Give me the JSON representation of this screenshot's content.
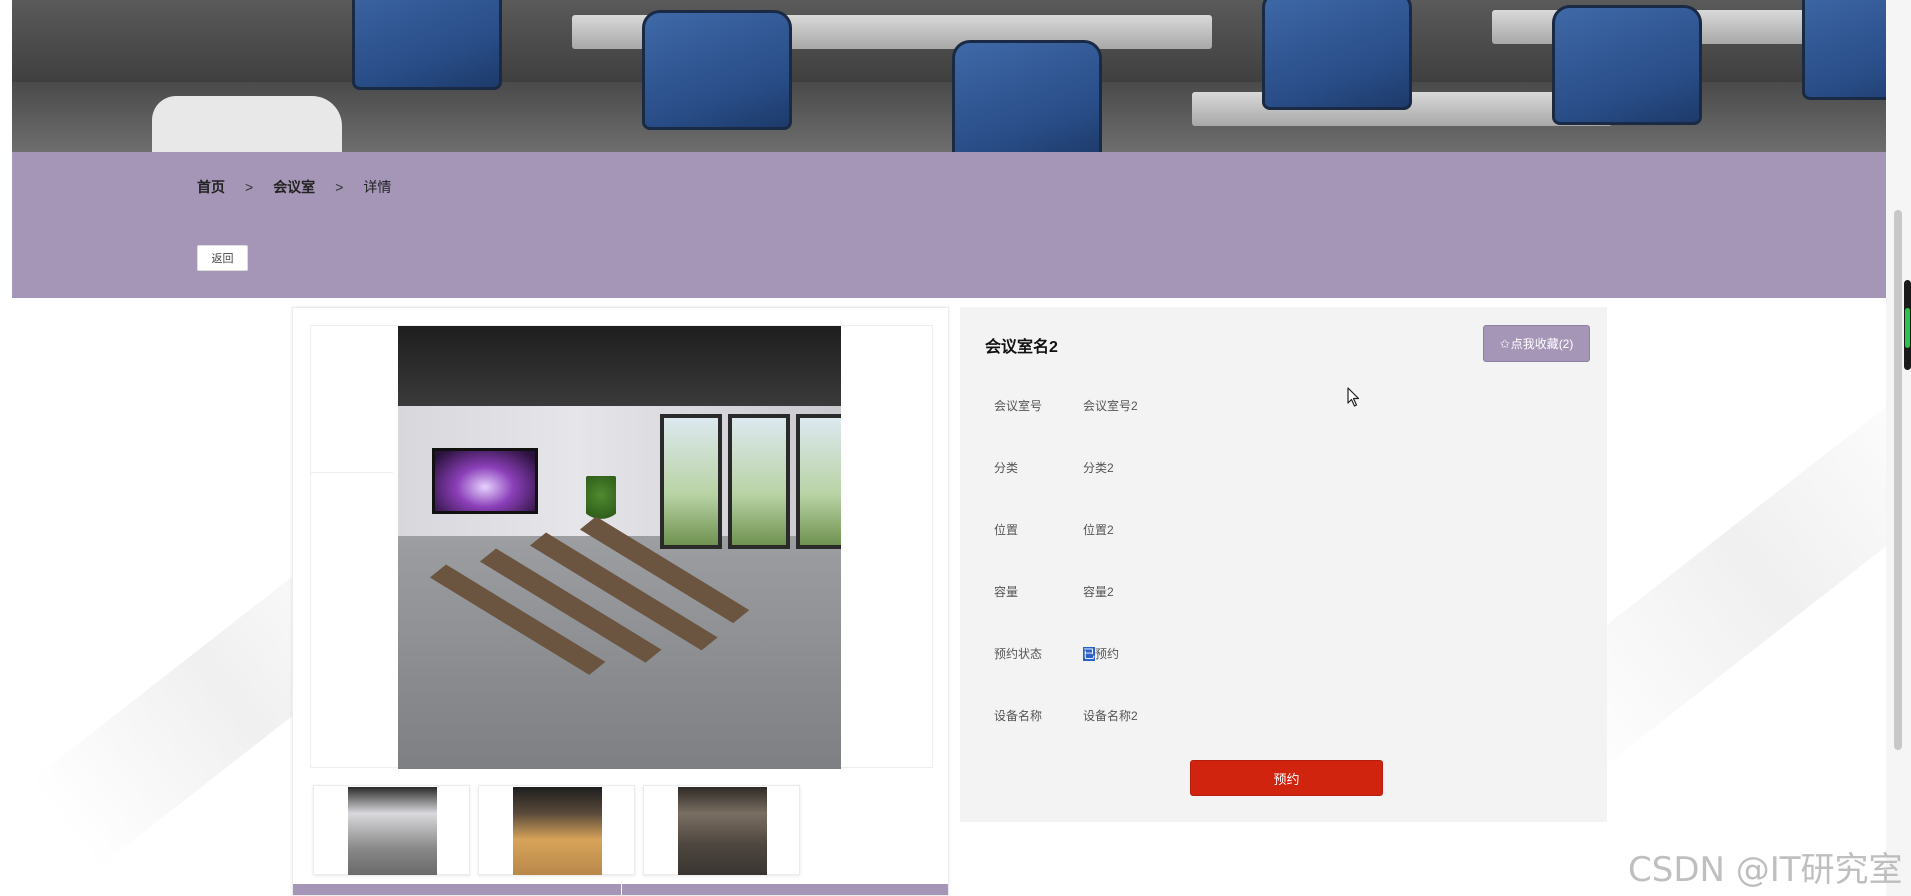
{
  "breadcrumb": {
    "home": "首页",
    "separator": ">",
    "section": "会议室",
    "current": "详情"
  },
  "back_button": "返回",
  "room": {
    "name": "会议室名2",
    "favorite_star": "✩",
    "favorite_label": "点我收藏(2)",
    "attributes": [
      {
        "label": "会议室号",
        "value": "会议室号2"
      },
      {
        "label": "分类",
        "value": "分类2"
      },
      {
        "label": "位置",
        "value": "位置2"
      },
      {
        "label": "容量",
        "value": "容量2"
      },
      {
        "label": "预约状态",
        "value_selected": "已",
        "value_rest": "预约"
      },
      {
        "label": "设备名称",
        "value": "设备名称2"
      }
    ],
    "reserve_label": "预约"
  },
  "thumbnails": [
    "meeting-room-thumb-1",
    "meeting-room-thumb-2",
    "meeting-room-thumb-3"
  ],
  "watermark": "CSDN @IT研究室",
  "colors": {
    "accent_purple": "#a596b8",
    "reserve_red": "#d0240f",
    "panel_gray": "#f3f3f3"
  }
}
